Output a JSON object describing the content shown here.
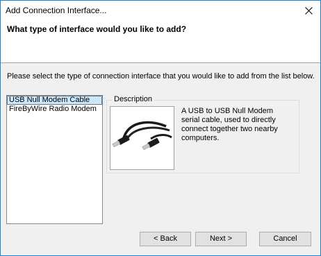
{
  "window": {
    "title": "Add Connection Interface..."
  },
  "header": {
    "question": "What type of interface would you like to add?"
  },
  "instruction": "Please select the type of connection interface that you would like to add from the list below.",
  "interfaces": [
    {
      "label": "USB Null Modem Cable",
      "selected": true
    },
    {
      "label": "FireByWire Radio Modem",
      "selected": false
    }
  ],
  "description": {
    "group_label": "Description",
    "text": "A USB to USB Null Modem serial cable, used to directly connect together two nearby computers.",
    "image_icon": "usb-cable-icon"
  },
  "buttons": {
    "back": "< Back",
    "next": "Next >",
    "cancel": "Cancel"
  },
  "icons": {
    "close": "close-icon"
  },
  "colors": {
    "window_border": "#1883d7",
    "selection": "#cce8ff"
  }
}
